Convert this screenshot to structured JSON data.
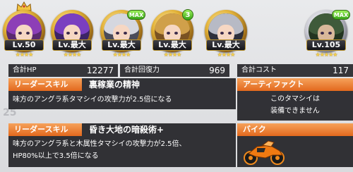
{
  "characters": [
    {
      "level": "Lv.50",
      "stars": "★★★★",
      "badge": "",
      "crown": true,
      "hair": "#8d3fb7",
      "medal": "gold"
    },
    {
      "level": "Lv.最大",
      "stars": "★★★★",
      "badge": "",
      "crown": false,
      "hair": "#7a3fc0",
      "medal": "gold"
    },
    {
      "level": "Lv.最大",
      "stars": "★★★★",
      "badge": "MAX",
      "crown": false,
      "hair": "#d5d7df",
      "medal": "gold"
    },
    {
      "level": "Lv.最大",
      "stars": "★★★★",
      "badge": "3",
      "crown": false,
      "hair": "#d0a04a",
      "medal": "gold"
    },
    {
      "level": "Lv.最大",
      "stars": "★★★★",
      "badge": "",
      "crown": false,
      "hair": "#b7bac5",
      "medal": "gold"
    },
    {
      "level": "Lv.105",
      "stars": "★★★★★",
      "badge": "MAX",
      "crown": false,
      "hair": "#3f5a3a",
      "medal": "silver"
    }
  ],
  "stats": {
    "hp_label": "合計HP",
    "hp_value": "12277",
    "heal_label": "合計回復力",
    "heal_value": "969",
    "cost_label": "合計コスト",
    "cost_value": "117"
  },
  "leader_skill_1": {
    "tag": "リーダースキル",
    "name": "裏稼業の精神",
    "desc": "味方のアングラ系タマシイの攻撃力が2.5倍になる"
  },
  "leader_skill_2": {
    "tag": "リーダースキル",
    "name": "昏き大地の暗殺術+",
    "desc_line1": "味方のアングラ系と木属性タマシイの攻撃力が2.5倍、",
    "desc_line2": "HP80%以上で3.5倍になる"
  },
  "artifact": {
    "tag": "アーティファクト",
    "line1": "このタマシイは",
    "line2": "装備できません"
  },
  "bike": {
    "tag": "バイク"
  },
  "colors": {
    "accent_orange": "#e2681d",
    "panel_dark": "#1e1e22",
    "badge_green": "#37a517",
    "star_gold": "#f7d24a"
  }
}
